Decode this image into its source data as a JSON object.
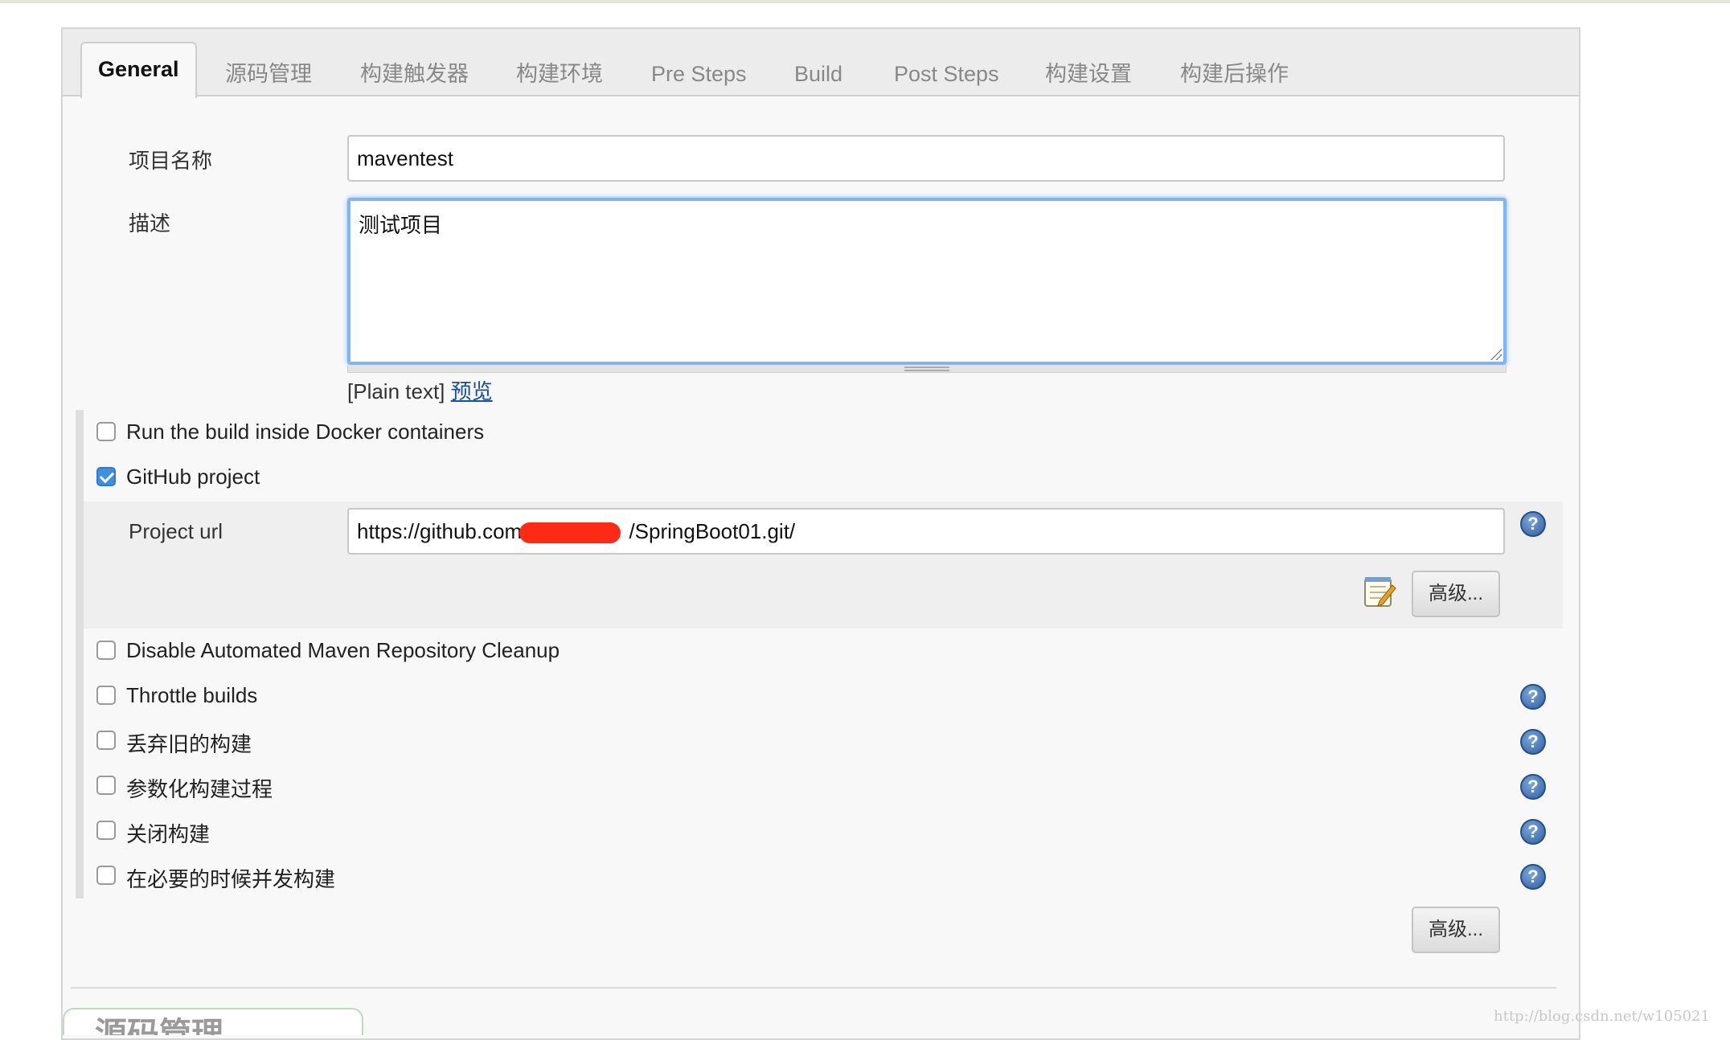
{
  "tabs": [
    {
      "label": "General"
    },
    {
      "label": "源码管理"
    },
    {
      "label": "构建触发器"
    },
    {
      "label": "构建环境"
    },
    {
      "label": "Pre Steps"
    },
    {
      "label": "Build"
    },
    {
      "label": "Post Steps"
    },
    {
      "label": "构建设置"
    },
    {
      "label": "构建后操作"
    }
  ],
  "general": {
    "name_label": "项目名称",
    "name_value": "maventest",
    "desc_label": "描述",
    "desc_value": "测试项目",
    "markup_format": "[Plain text]",
    "preview_link": "预览"
  },
  "options": {
    "docker": "Run the build inside Docker containers",
    "github": "GitHub project",
    "project_url_label": "Project url",
    "project_url_prefix": "https://github.com/",
    "project_url_suffix": "/SpringBoot01.git/",
    "advanced_label": "高级...",
    "maven_cleanup": "Disable Automated Maven Repository Cleanup",
    "throttle": "Throttle builds",
    "discard_old": "丢弃旧的构建",
    "parameterized": "参数化构建过程",
    "disable_build": "关闭构建",
    "concurrent": "在必要的时候并发构建",
    "advanced_label_2": "高级..."
  },
  "github_checked": true,
  "help_glyph": "?",
  "next_section_title": "源码管理",
  "watermark": "http://blog.csdn.net/w105021",
  "colors": {
    "accent": "#3d8fe0",
    "focus": "#7fb5f0",
    "link": "#1a4fa0",
    "redaction": "#ff2a16"
  }
}
